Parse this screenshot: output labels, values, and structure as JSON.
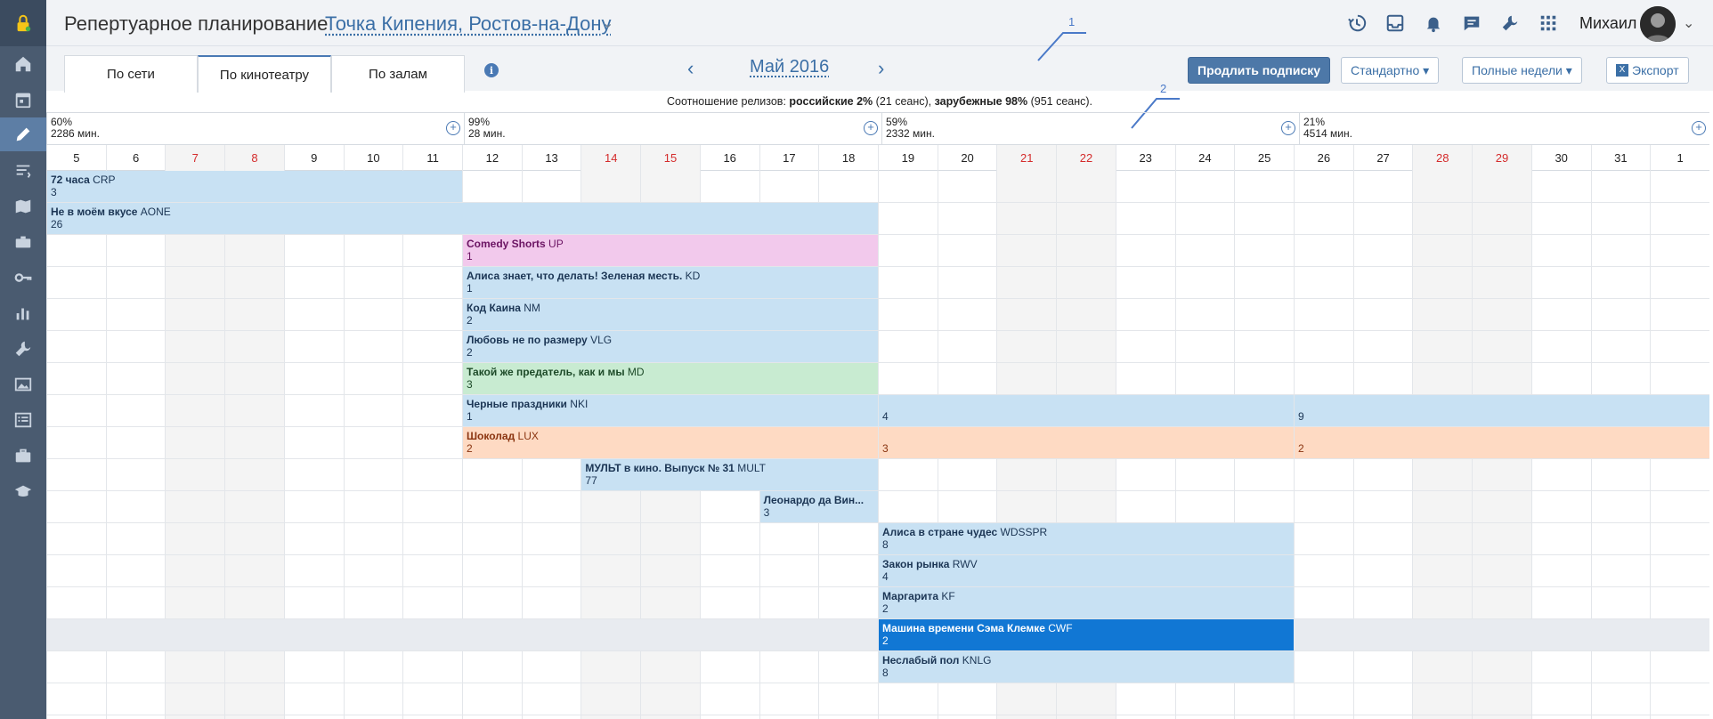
{
  "header": {
    "title": "Репертуарное планирование",
    "venue": "Точка Кипения, Ростов-на-Дону",
    "user": "Михаил"
  },
  "tabs": [
    "По сети",
    "По кинотеатру",
    "По залам"
  ],
  "active_tab": 1,
  "month": "Май 2016",
  "buttons": {
    "subscribe": "Продлить подписку",
    "standard": "Стандартно",
    "full_weeks": "Полные недели",
    "export": "Экспорт"
  },
  "annotations": [
    "1",
    "2"
  ],
  "ratio": {
    "prefix": "Соотношение релизов:",
    "ru_label": "российские 2%",
    "ru_count": "(21 сеанс)",
    "foreign_label": "зарубежные 98%",
    "foreign_count": "(951 сеанс)."
  },
  "weeks": [
    {
      "pct": "60%",
      "mins": "2286 мин."
    },
    {
      "pct": "99%",
      "mins": "28 мин."
    },
    {
      "pct": "59%",
      "mins": "2332 мин."
    },
    {
      "pct": "21%",
      "mins": "4514 мин."
    }
  ],
  "days": [
    "5",
    "6",
    "7",
    "8",
    "9",
    "10",
    "11",
    "12",
    "13",
    "14",
    "15",
    "16",
    "17",
    "18",
    "19",
    "20",
    "21",
    "22",
    "23",
    "24",
    "25",
    "26",
    "27",
    "28",
    "29",
    "30",
    "31",
    "1"
  ],
  "weekend_days": [
    "7",
    "8",
    "14",
    "15",
    "21",
    "22",
    "28",
    "29"
  ],
  "films": [
    {
      "row": 0,
      "segments": [
        {
          "name": "72 часа",
          "code": "CRP",
          "count": "3",
          "start": 0,
          "span": 7,
          "color": "blue"
        }
      ]
    },
    {
      "row": 1,
      "segments": [
        {
          "name": "Не в моём вкусе",
          "code": "AONE",
          "count": "26",
          "start": 0,
          "span": 14,
          "color": "blue"
        }
      ]
    },
    {
      "row": 2,
      "segments": [
        {
          "name": "Comedy Shorts",
          "code": "UP",
          "count": "1",
          "start": 7,
          "span": 7,
          "color": "pink"
        }
      ]
    },
    {
      "row": 3,
      "segments": [
        {
          "name": "Алиса знает, что делать! Зеленая месть.",
          "code": "KD",
          "count": "1",
          "start": 7,
          "span": 7,
          "color": "blue"
        }
      ]
    },
    {
      "row": 4,
      "segments": [
        {
          "name": "Код Каина",
          "code": "NM",
          "count": "2",
          "start": 7,
          "span": 7,
          "color": "blue"
        }
      ]
    },
    {
      "row": 5,
      "segments": [
        {
          "name": "Любовь не по размеру",
          "code": "VLG",
          "count": "2",
          "start": 7,
          "span": 7,
          "color": "blue"
        }
      ]
    },
    {
      "row": 6,
      "segments": [
        {
          "name": "Такой же предатель, как и мы",
          "code": "MD",
          "count": "3",
          "start": 7,
          "span": 7,
          "color": "green"
        }
      ]
    },
    {
      "row": 7,
      "segments": [
        {
          "name": "Черные праздники",
          "code": "NKI",
          "count": "1",
          "start": 7,
          "span": 7,
          "color": "blue"
        },
        {
          "name": "",
          "code": "",
          "count": "4",
          "start": 14,
          "span": 7,
          "color": "blue"
        },
        {
          "name": "",
          "code": "",
          "count": "9",
          "start": 21,
          "span": 7,
          "color": "blue"
        }
      ]
    },
    {
      "row": 8,
      "segments": [
        {
          "name": "Шоколад",
          "code": "LUX",
          "count": "2",
          "start": 7,
          "span": 7,
          "color": "peach"
        },
        {
          "name": "",
          "code": "",
          "count": "3",
          "start": 14,
          "span": 7,
          "color": "peach"
        },
        {
          "name": "",
          "code": "",
          "count": "2",
          "start": 21,
          "span": 7,
          "color": "peach"
        }
      ]
    },
    {
      "row": 9,
      "segments": [
        {
          "name": "МУЛЬТ в кино. Выпуск № 31",
          "code": "MULT",
          "count": "77",
          "start": 9,
          "span": 5,
          "color": "blue"
        }
      ]
    },
    {
      "row": 10,
      "segments": [
        {
          "name": "Леонардо да Вин...",
          "code": "",
          "count": "3",
          "start": 12,
          "span": 2,
          "color": "blue"
        }
      ]
    },
    {
      "row": 11,
      "segments": [
        {
          "name": "Алиса в стране чудес",
          "code": "WDSSPR",
          "count": "8",
          "start": 14,
          "span": 7,
          "color": "blue"
        }
      ]
    },
    {
      "row": 12,
      "segments": [
        {
          "name": "Закон рынка",
          "code": "RWV",
          "count": "4",
          "start": 14,
          "span": 7,
          "color": "blue"
        }
      ]
    },
    {
      "row": 13,
      "segments": [
        {
          "name": "Маргарита",
          "code": "KF",
          "count": "2",
          "start": 14,
          "span": 7,
          "color": "blue"
        }
      ]
    },
    {
      "row": 14,
      "segments": [
        {
          "name": "Машина времени Сэма Клемке",
          "code": "CWF",
          "count": "2",
          "start": 14,
          "span": 7,
          "color": "sel"
        }
      ]
    },
    {
      "row": 15,
      "segments": [
        {
          "name": "Неслабый пол",
          "code": "KNLG",
          "count": "8",
          "start": 14,
          "span": 7,
          "color": "blue"
        }
      ]
    }
  ],
  "sidebar_icons": [
    "lock-icon",
    "home-icon",
    "calendar-icon",
    "pencil-icon",
    "sort-icon",
    "map-icon",
    "projector-icon",
    "key-icon",
    "chart-icon",
    "wrench-icon",
    "gallery-icon",
    "list-icon",
    "briefcase-icon",
    "graduation-icon"
  ],
  "topbar_icons": [
    "history-icon",
    "inbox-icon",
    "bell-icon",
    "chat-icon",
    "wrench-icon",
    "apps-grid-icon"
  ]
}
